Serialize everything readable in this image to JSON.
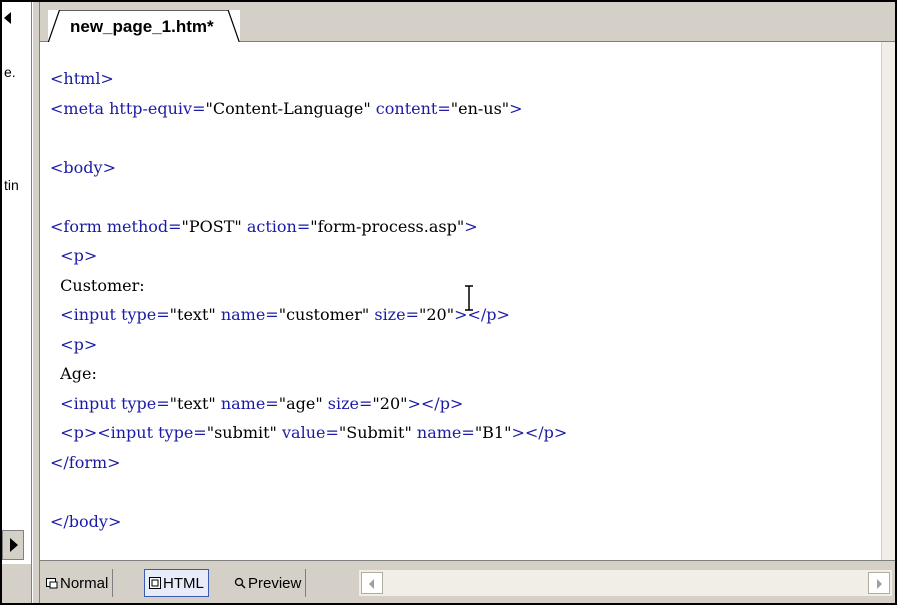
{
  "left_panel": {
    "fragments": [
      "e.",
      "tin"
    ]
  },
  "tab": {
    "label": "new_page_1.htm*"
  },
  "code_lines": [
    [
      {
        "t": "tag",
        "v": "<html>"
      }
    ],
    [
      {
        "t": "tag",
        "v": "<meta http-equiv="
      },
      {
        "t": "str",
        "v": "\"Content-Language\""
      },
      {
        "t": "tag",
        "v": " content="
      },
      {
        "t": "str",
        "v": "\"en-us\""
      },
      {
        "t": "tag",
        "v": ">"
      }
    ],
    [],
    [
      {
        "t": "tag",
        "v": "<body>"
      }
    ],
    [],
    [
      {
        "t": "tag",
        "v": "<form method="
      },
      {
        "t": "str",
        "v": "\"POST\""
      },
      {
        "t": "tag",
        "v": " action="
      },
      {
        "t": "str",
        "v": "\"form-process.asp\""
      },
      {
        "t": "tag",
        "v": ">"
      }
    ],
    [
      {
        "t": "txt",
        "v": "  "
      },
      {
        "t": "tag",
        "v": "<p>"
      }
    ],
    [
      {
        "t": "txt",
        "v": "  Customer:"
      }
    ],
    [
      {
        "t": "txt",
        "v": "  "
      },
      {
        "t": "tag",
        "v": "<input type="
      },
      {
        "t": "str",
        "v": "\"text\""
      },
      {
        "t": "tag",
        "v": " name="
      },
      {
        "t": "str",
        "v": "\"customer\""
      },
      {
        "t": "tag",
        "v": " size="
      },
      {
        "t": "str",
        "v": "\"20\""
      },
      {
        "t": "tag",
        "v": "></p>"
      }
    ],
    [
      {
        "t": "txt",
        "v": "  "
      },
      {
        "t": "tag",
        "v": "<p>"
      }
    ],
    [
      {
        "t": "txt",
        "v": "  Age:"
      }
    ],
    [
      {
        "t": "txt",
        "v": "  "
      },
      {
        "t": "tag",
        "v": "<input type="
      },
      {
        "t": "str",
        "v": "\"text\""
      },
      {
        "t": "tag",
        "v": " name="
      },
      {
        "t": "str",
        "v": "\"age\""
      },
      {
        "t": "tag",
        "v": " size="
      },
      {
        "t": "str",
        "v": "\"20\""
      },
      {
        "t": "tag",
        "v": "></p>"
      }
    ],
    [
      {
        "t": "txt",
        "v": "  "
      },
      {
        "t": "tag",
        "v": "<p><input type="
      },
      {
        "t": "str",
        "v": "\"submit\""
      },
      {
        "t": "tag",
        "v": " value="
      },
      {
        "t": "str",
        "v": "\"Submit\""
      },
      {
        "t": "tag",
        "v": " name="
      },
      {
        "t": "str",
        "v": "\"B1\""
      },
      {
        "t": "tag",
        "v": "></p>"
      }
    ],
    [
      {
        "t": "tag",
        "v": "</form>"
      }
    ],
    [],
    [
      {
        "t": "tag",
        "v": "</body>"
      }
    ]
  ],
  "view_tabs": {
    "normal": "Normal",
    "html": "HTML",
    "preview": "Preview"
  },
  "colors": {
    "tag": "#1a1aa6",
    "text": "#000000",
    "active_tab_border": "#3a5bb0"
  }
}
